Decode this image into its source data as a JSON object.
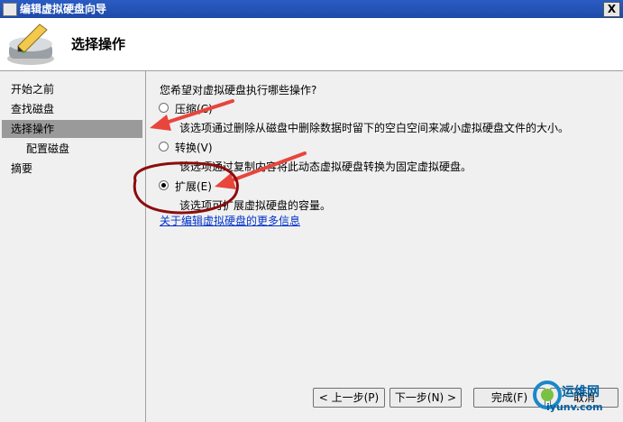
{
  "window": {
    "title": "编辑虚拟硬盘向导",
    "close_glyph": "X"
  },
  "header": {
    "title": "选择操作"
  },
  "nav": {
    "items": [
      {
        "label": "开始之前"
      },
      {
        "label": "查找磁盘"
      },
      {
        "label": "选择操作"
      },
      {
        "label": "配置磁盘"
      },
      {
        "label": "摘要"
      }
    ]
  },
  "main": {
    "question": "您希望对虚拟硬盘执行哪些操作?",
    "options": [
      {
        "label": "压缩(C)",
        "description": "该选项通过删除从磁盘中删除数据时留下的空白空间来减小虚拟硬盘文件的大小。",
        "checked": false
      },
      {
        "label": "转换(V)",
        "description": "该选项通过复制内容将此动态虚拟硬盘转换为固定虚拟硬盘。",
        "checked": false
      },
      {
        "label": "扩展(E)",
        "description": "该选项可扩展虚拟硬盘的容量。",
        "checked": true
      }
    ],
    "more_info_link": "关于编辑虚拟硬盘的更多信息"
  },
  "buttons": {
    "previous": "< 上一步(P)",
    "next": "下一步(N) >",
    "finish": "完成(F)",
    "cancel": "取消"
  },
  "watermark": {
    "line1": "运维网",
    "line2": "iyunv.com"
  },
  "colors": {
    "title_bar": "#2a5cc4",
    "nav_selected": "#9a9a9a",
    "link": "#0033cc",
    "annotation_arrow": "#e8453c",
    "annotation_circle": "#8b0d0d"
  }
}
